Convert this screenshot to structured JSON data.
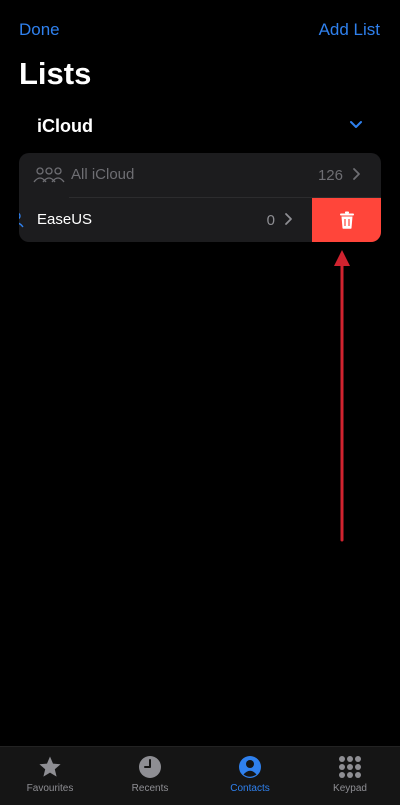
{
  "nav": {
    "done_label": "Done",
    "add_list_label": "Add List"
  },
  "page": {
    "title": "Lists"
  },
  "section": {
    "title": "iCloud"
  },
  "lists": [
    {
      "label": "All iCloud",
      "count": "126"
    },
    {
      "label": "EaseUS",
      "count": "0"
    }
  ],
  "tabs": [
    {
      "label": "Favourites",
      "icon": "star-icon"
    },
    {
      "label": "Recents",
      "icon": "clock-icon"
    },
    {
      "label": "Contacts",
      "icon": "person-circle-icon"
    },
    {
      "label": "Keypad",
      "icon": "keypad-icon"
    }
  ],
  "colors": {
    "accent": "#2f80ed",
    "delete": "#ff453a",
    "annotation_arrow": "#d0232f"
  },
  "active_tab": "Contacts"
}
